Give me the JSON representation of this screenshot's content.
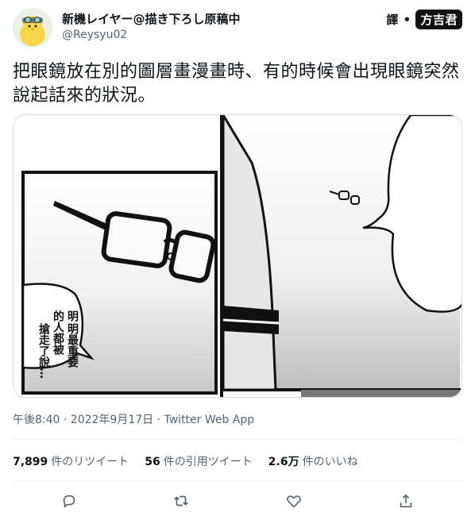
{
  "author": {
    "display_name": "新機レイヤー@描き下ろし原稿中",
    "handle": "@Reysyu02",
    "avatar_icon": "chick-avatar-icon"
  },
  "translator_badge": {
    "prefix": "譯",
    "name": "方吉君"
  },
  "tweet": {
    "text": "把眼鏡放在別的圖層畫漫畫時、有的時候會出現眼鏡突然說起話來的狀況。"
  },
  "comic": {
    "speech_lines": [
      "明",
      "明最重要",
      "的人都被",
      "搶走了說…"
    ]
  },
  "meta": {
    "timestamp": "午後8:40 · 2022年9月17日 · Twitter Web App"
  },
  "stats": {
    "retweets_count": "7,899",
    "retweets_label": "件のリツイート",
    "quotes_count": "56",
    "quotes_label": "件の引用ツイート",
    "likes_count": "2.6万",
    "likes_label": "件のいいね"
  },
  "actions": {
    "reply": "reply-icon",
    "retweet": "retweet-icon",
    "like": "heart-icon",
    "share": "share-icon"
  }
}
